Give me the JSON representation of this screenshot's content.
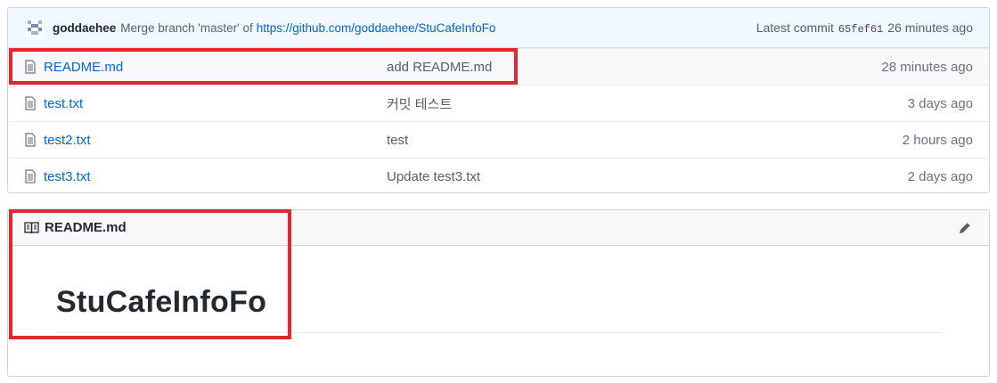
{
  "commit_bar": {
    "author": "goddaehee",
    "message": "Merge branch 'master' of",
    "link": "https://github.com/goddaehee/StuCafeInfoFo",
    "latest_label": "Latest commit",
    "sha": "65fef61",
    "age": "26 minutes ago"
  },
  "files": [
    {
      "name": "README.md",
      "commit": "add README.md",
      "age": "28 minutes ago",
      "icon": "file-icon"
    },
    {
      "name": "test.txt",
      "commit": "커밋 테스트",
      "age": "3 days ago",
      "icon": "file-icon"
    },
    {
      "name": "test2.txt",
      "commit": "test",
      "age": "2 hours ago",
      "icon": "file-icon"
    },
    {
      "name": "test3.txt",
      "commit": "Update test3.txt",
      "age": "2 days ago",
      "icon": "file-icon"
    }
  ],
  "readme": {
    "header_title": "README.md",
    "heading": "StuCafeInfoFo",
    "header_icon": "book-icon",
    "edit_icon": "pencil-icon"
  },
  "colors": {
    "link": "#0366d6",
    "annotation": "#e3262f",
    "commit_bar_bg": "#f1f8ff"
  }
}
